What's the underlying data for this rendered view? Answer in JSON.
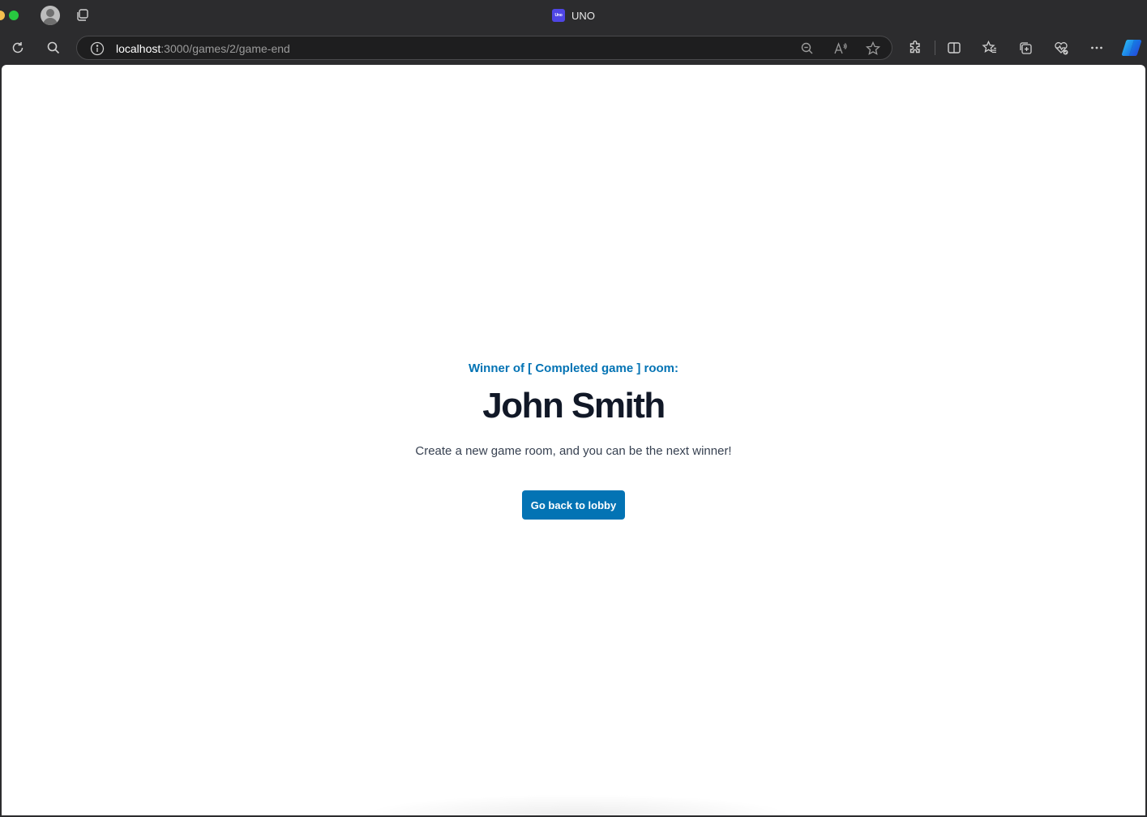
{
  "browser": {
    "tab_title": "UNO",
    "favicon_text": "Uno",
    "url_host": "localhost",
    "url_path": ":3000/games/2/game-end",
    "icons": {
      "profile": "profile-avatar-icon",
      "tabs": "tab-actions-icon",
      "refresh": "refresh-icon",
      "search": "search-icon",
      "info": "site-info-icon",
      "zoom_out": "zoom-out-icon",
      "read_aloud": "read-aloud-icon",
      "favorite": "favorite-star-icon",
      "extensions": "extensions-icon",
      "split_screen": "split-screen-icon",
      "favorites": "favorites-icon",
      "collections": "collections-icon",
      "performance": "browser-essentials-icon",
      "more": "more-menu-icon",
      "copilot": "copilot-icon"
    }
  },
  "page": {
    "eyebrow": "Winner of [ Completed game ] room:",
    "winner_name": "John Smith",
    "subtext": "Create a new game room, and you can be the next winner!",
    "button_label": "Go back to lobby"
  },
  "colors": {
    "accent": "#0373b4",
    "heading": "#111827",
    "body_text": "#374151",
    "chrome_bg": "#2c2c2e"
  }
}
